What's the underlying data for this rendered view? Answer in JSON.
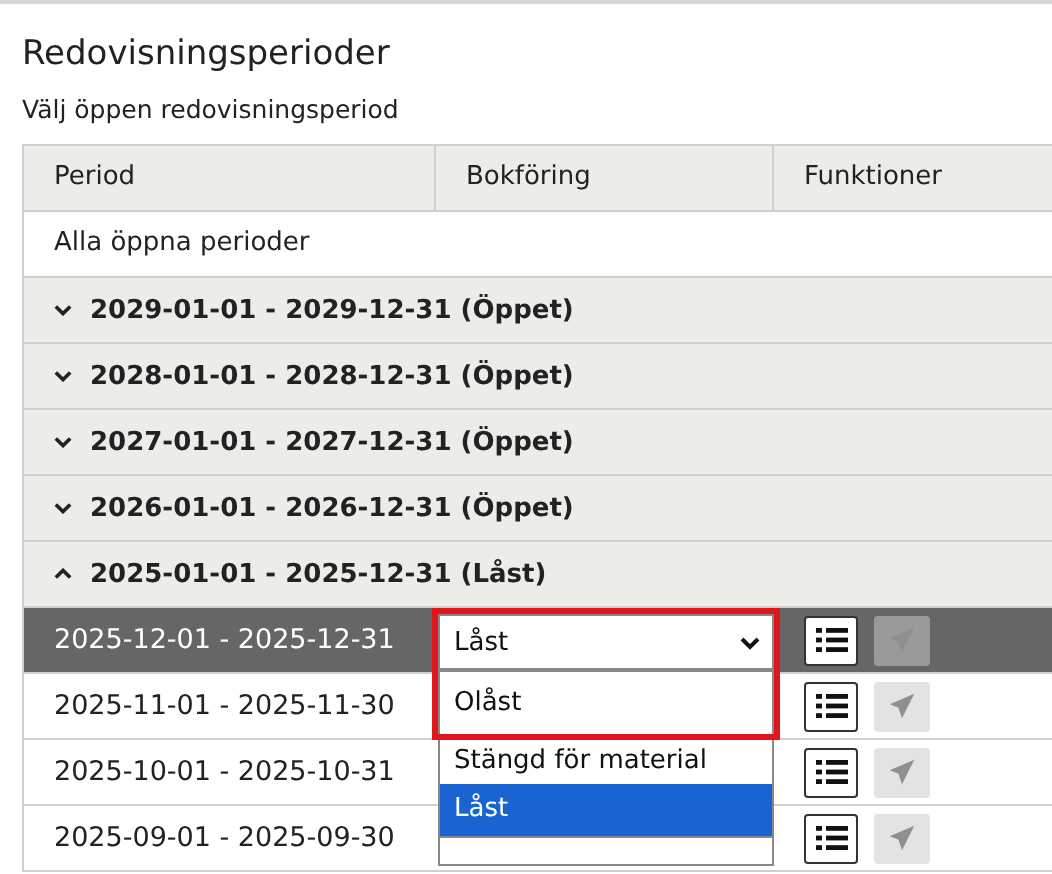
{
  "title": "Redovisningsperioder",
  "subtitle": "Välj öppen redovisningsperiod",
  "table": {
    "columns": [
      "Period",
      "Bokföring",
      "Funktioner"
    ],
    "all_row": "Alla öppna perioder",
    "groups": [
      {
        "label": "2029-01-01 - 2029-12-31 (Öppet)",
        "expanded": false
      },
      {
        "label": "2028-01-01 - 2028-12-31 (Öppet)",
        "expanded": false
      },
      {
        "label": "2027-01-01 - 2027-12-31 (Öppet)",
        "expanded": false
      },
      {
        "label": "2026-01-01 - 2026-12-31 (Öppet)",
        "expanded": false
      },
      {
        "label": "2025-01-01 - 2025-12-31 (Låst)",
        "expanded": true
      }
    ],
    "rows": [
      {
        "period": "2025-12-01 - 2025-12-31",
        "status": "Låst",
        "selected": true,
        "send_disabled": true
      },
      {
        "period": "2025-11-01 - 2025-11-30",
        "selected": false,
        "send_disabled": true
      },
      {
        "period": "2025-10-01 - 2025-10-31",
        "selected": false,
        "send_disabled": true
      },
      {
        "period": "2025-09-01 - 2025-09-30",
        "selected": false,
        "send_disabled": true
      }
    ]
  },
  "dropdown": {
    "highlighted": true,
    "options": [
      {
        "label": "Olåst",
        "selected": false
      },
      {
        "label": "Stängd för material",
        "selected": false
      },
      {
        "label": "Låst",
        "selected": true
      }
    ]
  }
}
